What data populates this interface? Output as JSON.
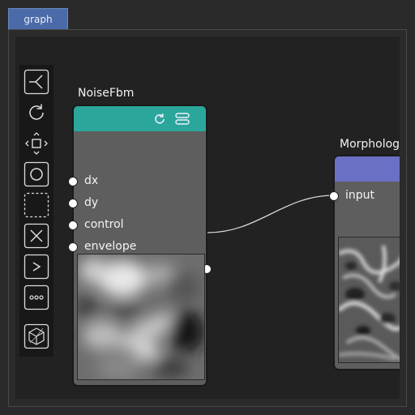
{
  "tab": {
    "label": "graph"
  },
  "toolbar": {
    "tools": [
      "layout-branch-icon",
      "reload-icon",
      "move-arrows-icon",
      "circle-icon",
      "dashed-square-icon",
      "close-icon",
      "chevron-right-icon",
      "more-dots-icon",
      "cube-3d-icon"
    ]
  },
  "nodes": {
    "noise": {
      "title": "NoiseFbm",
      "header_color": "#2aa79a",
      "inputs": [
        "dx",
        "dy",
        "control",
        "envelope"
      ],
      "output": "output"
    },
    "morph": {
      "title": "Morpholog",
      "header_color": "#6a70c4",
      "input": "input"
    }
  },
  "colors": {
    "background": "#2a2a2a",
    "canvas": "#222222",
    "tab": "#4a6aa8",
    "node_body": "#5e5e5e",
    "link": "#d8d8d8"
  }
}
